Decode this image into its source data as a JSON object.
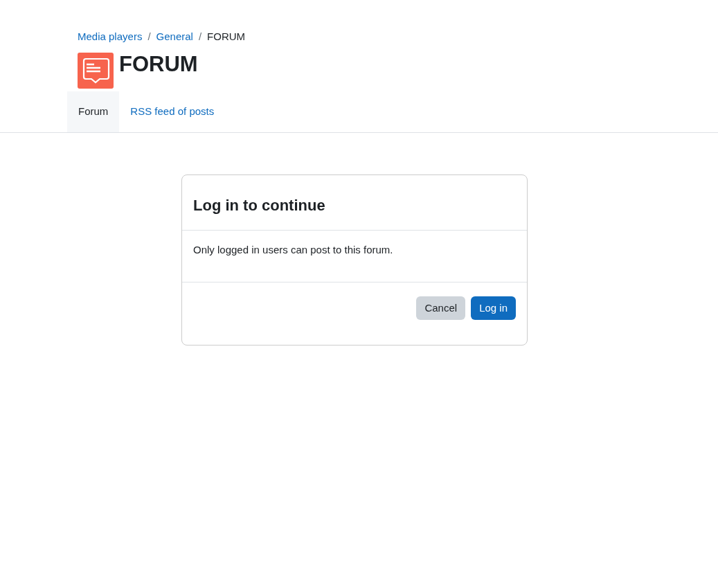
{
  "breadcrumb": [
    {
      "kind": "link",
      "label": "Media players"
    },
    {
      "kind": "separator",
      "label": "/"
    },
    {
      "kind": "link",
      "label": "General"
    },
    {
      "kind": "separator",
      "label": "/"
    },
    {
      "kind": "current",
      "label": "FORUM"
    }
  ],
  "page_title": "FORUM",
  "tabs": [
    {
      "label": "Forum",
      "selected": true
    },
    {
      "label": "RSS feed of posts",
      "selected": false
    }
  ],
  "dialog": {
    "title": "Log in to continue",
    "message": "Only logged in users can post to this forum.",
    "buttons": [
      {
        "label": "Cancel",
        "kind": "secondary"
      },
      {
        "label": "Log in",
        "kind": "primary"
      }
    ]
  }
}
